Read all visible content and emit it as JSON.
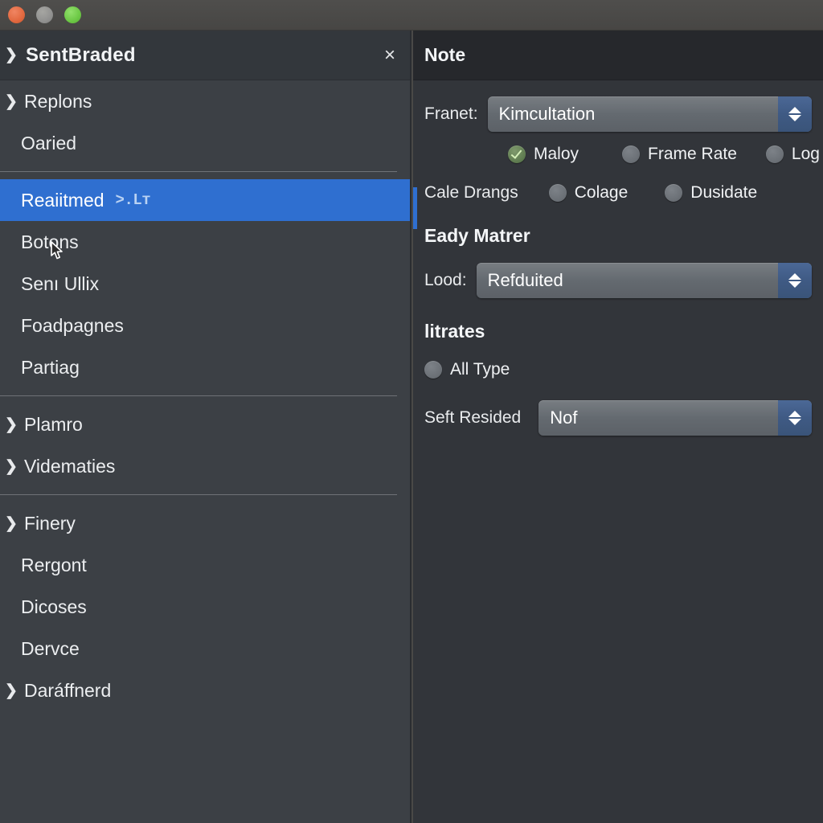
{
  "window": {
    "traffic_lights": [
      "close-red",
      "minimize-yellow",
      "zoom-green"
    ]
  },
  "sidebar": {
    "title": "SentBraded",
    "close_label": "×",
    "chevron": "❯",
    "groups": [
      {
        "items": [
          {
            "label": "Replons",
            "expandable": true,
            "selected": false
          },
          {
            "label": "Oaried",
            "expandable": false,
            "selected": false
          }
        ]
      },
      {
        "items": [
          {
            "label": "Reaiitmed",
            "expandable": false,
            "selected": true,
            "badge": ">.Lт"
          },
          {
            "label": "Botons",
            "expandable": false,
            "selected": false
          },
          {
            "label": "Senı Ullix",
            "expandable": false,
            "selected": false
          },
          {
            "label": "Foadpagnes",
            "expandable": false,
            "selected": false
          },
          {
            "label": "Partiag",
            "expandable": false,
            "selected": false
          }
        ]
      },
      {
        "items": [
          {
            "label": "Plamro",
            "expandable": true,
            "selected": false
          },
          {
            "label": "Vidematies",
            "expandable": true,
            "selected": false
          }
        ]
      },
      {
        "items": [
          {
            "label": "Finery",
            "expandable": true,
            "selected": false
          },
          {
            "label": "Rergont",
            "expandable": false,
            "selected": false
          },
          {
            "label": "Dicoses",
            "expandable": false,
            "selected": false
          },
          {
            "label": "Dervce",
            "expandable": false,
            "selected": false
          },
          {
            "label": "Daráffnerd",
            "expandable": true,
            "selected": false
          }
        ]
      }
    ]
  },
  "panel": {
    "title": "Note",
    "franet": {
      "label": "Franet:",
      "value": "Kimcultation"
    },
    "mode_radios": [
      {
        "label": "Maloy",
        "selected": true
      },
      {
        "label": "Frame Rate",
        "selected": false
      },
      {
        "label": "Log",
        "selected": false
      }
    ],
    "drangs": {
      "label": "Cale Drangs",
      "options": [
        {
          "label": "Colage",
          "selected": false
        },
        {
          "label": "Dusidate",
          "selected": false
        }
      ]
    },
    "matrer": {
      "section_title": "Eady Matrer",
      "lood": {
        "label": "Lood:",
        "value": "Refduited"
      }
    },
    "litrates": {
      "section_title": "litrates",
      "all_type": {
        "label": "All Type",
        "selected": false
      },
      "seft_resided": {
        "label": "Seft Resided",
        "value": "Nof"
      }
    }
  },
  "colors": {
    "accent_blue": "#2f6fd0",
    "sidebar_bg": "#3c4045",
    "panel_bg": "#32353a",
    "header_bg": "#26282c",
    "stepper_blue": "#3f5a84",
    "selected_green": "#5f7c50"
  }
}
